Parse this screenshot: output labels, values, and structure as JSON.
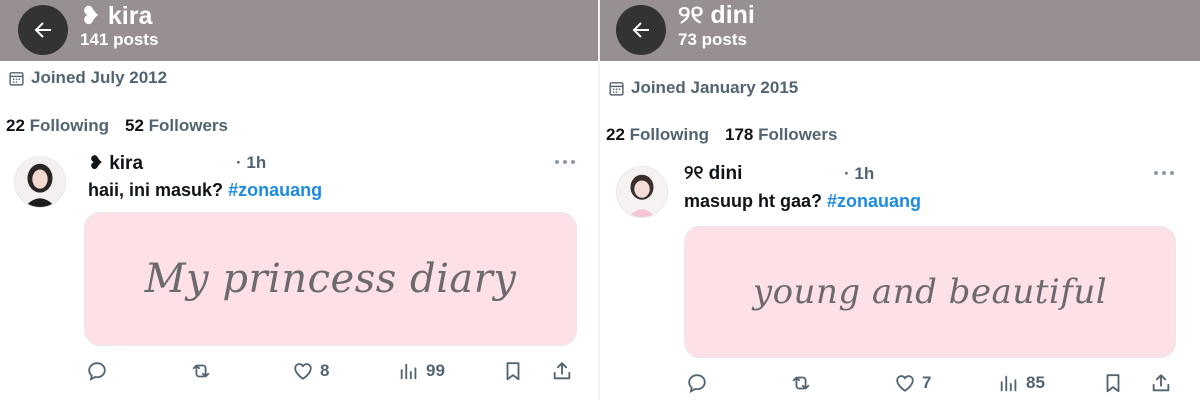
{
  "left": {
    "header": {
      "name": "❥ kira",
      "posts": "141 posts"
    },
    "joined": "Joined July 2012",
    "following_count": "22",
    "following_label": "Following",
    "followers_count": "52",
    "followers_label": "Followers",
    "tweet": {
      "name": "❥ kira",
      "time": "· 1h",
      "text": "haii, ini masuk?",
      "hashtag": "#zonauang",
      "media_text": "My princess diary",
      "likes": "8",
      "views": "99"
    }
  },
  "right": {
    "header": {
      "name": "୨୧ dini",
      "posts": "73 posts"
    },
    "joined": "Joined January 2015",
    "following_count": "22",
    "following_label": "Following",
    "followers_count": "178",
    "followers_label": "Followers",
    "tweet": {
      "name": "୨୧ dini",
      "time": "· 1h",
      "text": "masuup ht gaa?",
      "hashtag": "#zonauang",
      "media_text": "young and beautiful",
      "likes": "7",
      "views": "85"
    }
  },
  "icons": {
    "back": "arrow-left-icon",
    "calendar": "calendar-icon",
    "more": "more-dots-icon",
    "reply": "reply-icon",
    "retweet": "retweet-icon",
    "like": "heart-icon",
    "views": "views-icon",
    "bookmark": "bookmark-icon",
    "share": "share-icon"
  },
  "colors": {
    "header_bg": "#989090",
    "hashtag": "#1d8ce0",
    "media_bg": "#fde1e6",
    "muted": "#536471"
  }
}
